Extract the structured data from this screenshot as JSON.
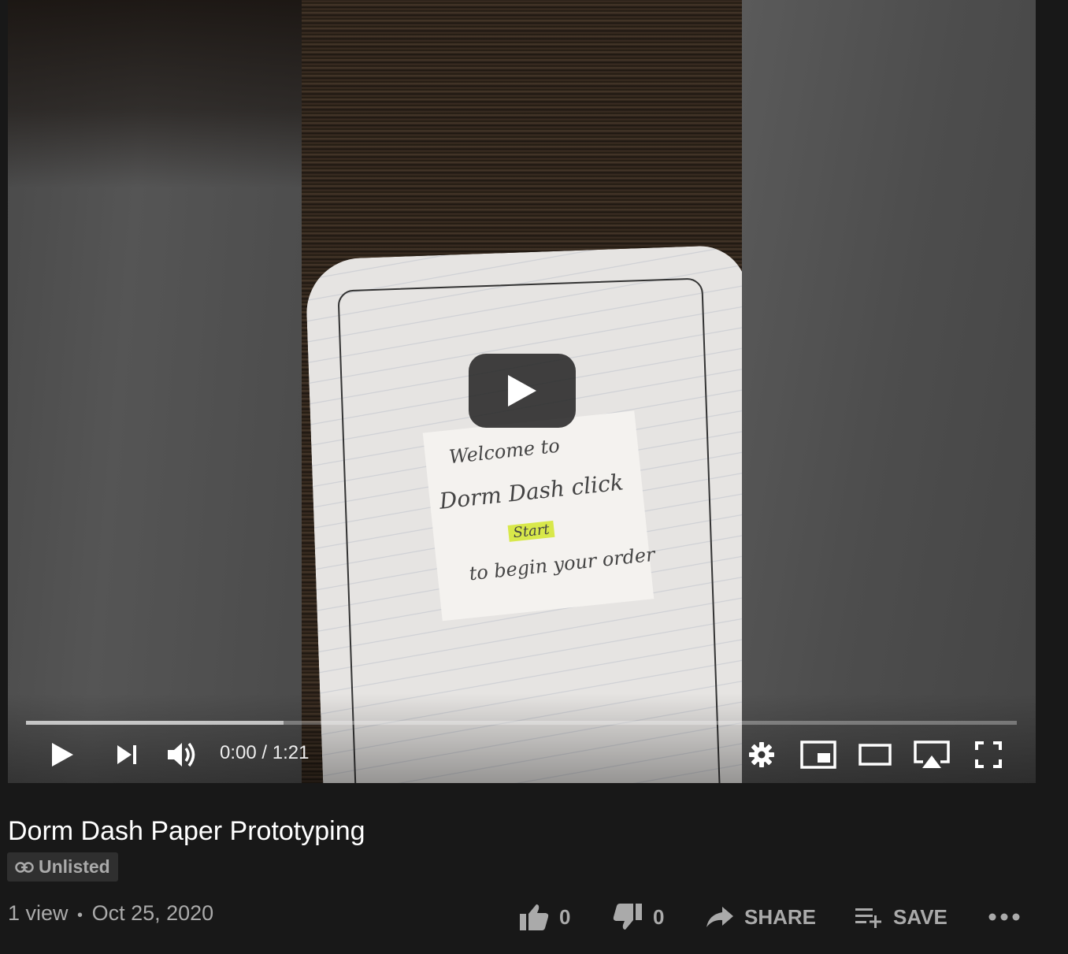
{
  "player": {
    "time_display": "0:00 / 1:21",
    "progress_fraction": 0.0,
    "buffered_fraction": 0.26
  },
  "video_frame_text": {
    "line1": "Welcome to",
    "line2": "Dorm Dash click",
    "line3": "Start",
    "line4": "to begin your order"
  },
  "video": {
    "title": "Dorm Dash Paper Prototyping",
    "privacy_badge": "Unlisted",
    "views": "1 view",
    "separator": "•",
    "date": "Oct 25, 2020"
  },
  "actions": {
    "like_count": "0",
    "dislike_count": "0",
    "share_label": "SHARE",
    "save_label": "SAVE"
  },
  "colors": {
    "page_bg": "#181818",
    "secondary_text": "#aaaaaa",
    "highlighter": "#d8e84a"
  },
  "icons": [
    "play-icon",
    "next-icon",
    "volume-icon",
    "settings-icon",
    "miniplayer-icon",
    "theater-icon",
    "airplay-icon",
    "fullscreen-icon",
    "link-icon",
    "thumb-up-icon",
    "thumb-down-icon",
    "share-icon",
    "playlist-add-icon",
    "more-icon"
  ]
}
